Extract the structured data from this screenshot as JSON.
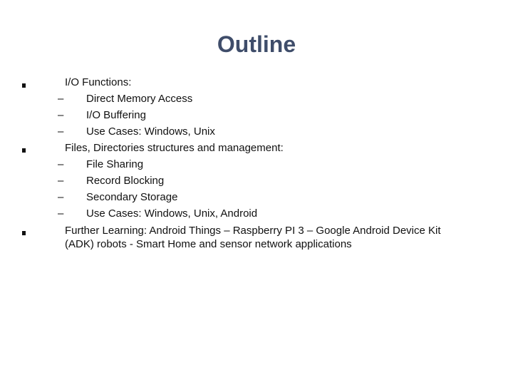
{
  "slide": {
    "title": "Outline",
    "title_color": "#3f4d6a",
    "bullet_icon": "square-bullet",
    "dash_glyph": "–",
    "sections": [
      {
        "text": "I/O Functions:",
        "items": [
          "Direct Memory Access",
          "I/O Buffering",
          "Use Cases: Windows, Unix"
        ]
      },
      {
        "text": "Files, Directories structures and management:",
        "items": [
          "File Sharing",
          "Record Blocking",
          "Secondary Storage",
          "Use Cases: Windows, Unix, Android"
        ]
      },
      {
        "text_lines": [
          "Further Learning: Android Things – Raspberry PI 3 – Google Android Device Kit",
          "(ADK) robots  - Smart Home and sensor network applications"
        ]
      }
    ]
  }
}
